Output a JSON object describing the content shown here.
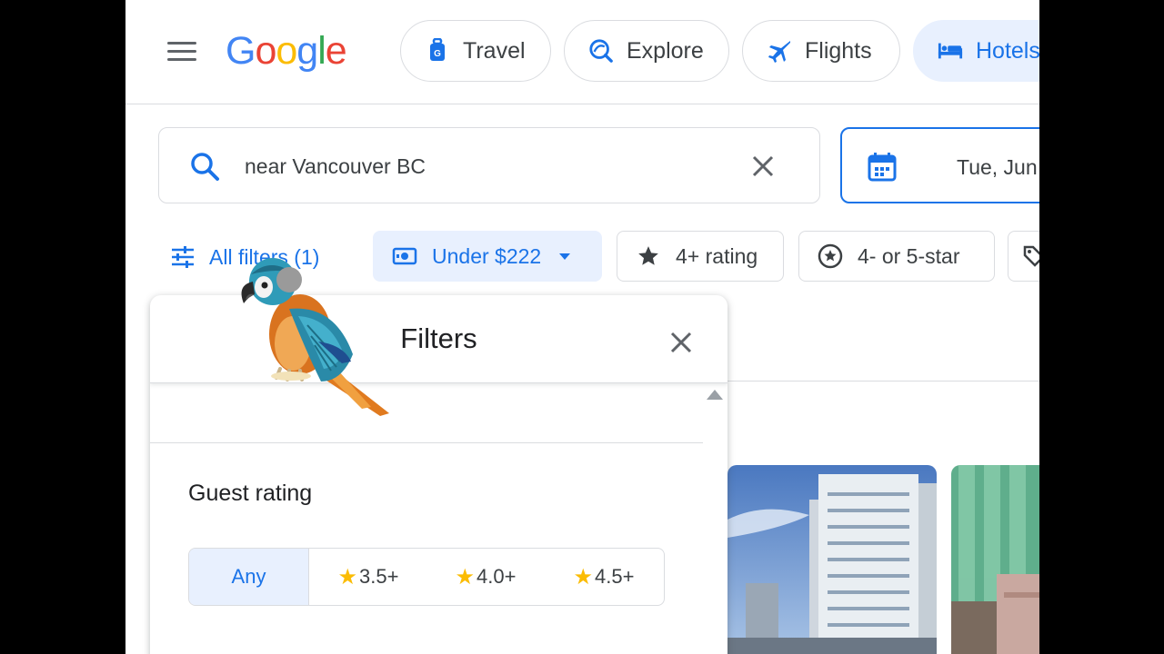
{
  "header": {
    "logo_letters": [
      {
        "ch": "G",
        "color": "#4285F4"
      },
      {
        "ch": "o",
        "color": "#EA4335"
      },
      {
        "ch": "o",
        "color": "#FBBC05"
      },
      {
        "ch": "g",
        "color": "#4285F4"
      },
      {
        "ch": "l",
        "color": "#34A853"
      },
      {
        "ch": "e",
        "color": "#EA4335"
      }
    ],
    "nav": [
      {
        "label": "Travel",
        "icon": "luggage-icon"
      },
      {
        "label": "Explore",
        "icon": "explore-icon"
      },
      {
        "label": "Flights",
        "icon": "airplane-icon"
      },
      {
        "label": "Hotels",
        "icon": "bed-icon",
        "active": true
      }
    ]
  },
  "search": {
    "value": "near Vancouver BC",
    "date": "Tue, Jun"
  },
  "filters_row": {
    "all_filters": "All filters (1)",
    "price": "Under $222",
    "rating": "4+ rating",
    "class": "4- or 5-star"
  },
  "panel": {
    "title": "Filters",
    "guest_rating": {
      "heading": "Guest rating",
      "options": [
        "Any",
        "3.5+",
        "4.0+",
        "4.5+"
      ],
      "selected": "Any"
    }
  },
  "colors": {
    "accent": "#1a73e8",
    "accent_bg": "#e8f0fe",
    "star": "#fbbc04"
  }
}
